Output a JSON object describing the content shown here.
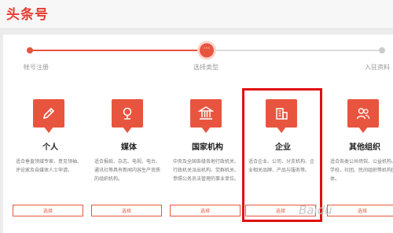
{
  "header": {
    "logo_text": "头条号"
  },
  "steps": [
    {
      "label": "帐号注册",
      "state": "done"
    },
    {
      "label": "选择类型",
      "state": "current",
      "glyph": "···"
    },
    {
      "label": "入驻资料",
      "state": "todo"
    }
  ],
  "cards": [
    {
      "title": "个人",
      "icon": "pen-icon",
      "description": "适合垂直领域专家、意见领袖、评论家及自媒体人士申请。",
      "button": "选择"
    },
    {
      "title": "媒体",
      "icon": "pin-icon",
      "description": "适合报纸、杂志、电视、电台、通讯社等具有新闻内容生产资质的组织机构。",
      "button": "选择"
    },
    {
      "title": "国家机构",
      "icon": "bank-icon",
      "description": "中央及全国各级各地行政机关、行政机关派出机构、党群机关、参照公务员法管理的事业单位。",
      "button": "选择"
    },
    {
      "title": "企业",
      "icon": "building-icon",
      "description": "适合企业、公司、分支机构、企业相关品牌、产品与服务等。",
      "button": "选择",
      "highlighted": true
    },
    {
      "title": "其他组织",
      "icon": "people-icon",
      "description": "适合各类公共场馆、公益机构、学校、社团、民间组织等机构团体。",
      "button": "选择"
    }
  ],
  "watermark": {
    "text": "Baidu"
  },
  "colors": {
    "accent": "#e8553f",
    "logo": "#e33a2f",
    "highlight_frame": "#e01010"
  }
}
